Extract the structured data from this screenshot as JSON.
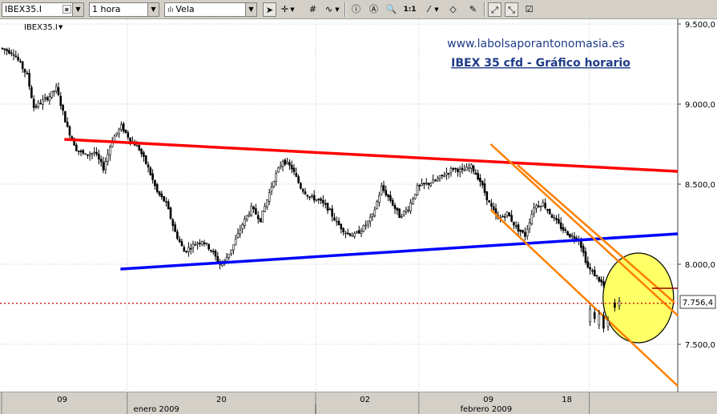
{
  "toolbar": {
    "symbol": "IBEX35.I",
    "timeframe": "1 hora",
    "chart_style": "Vela",
    "tools": [
      "cursor-arrow",
      "crosshair",
      "grid",
      "indicator",
      "info",
      "zoom",
      "one-to-one",
      "line-draw",
      "eraser",
      "highlighter",
      "auto-scale",
      "checkbox"
    ]
  },
  "chart_data": {
    "type": "candlestick",
    "symbol_label": "IBEX35.I",
    "source_text": "www.labolsaporantonomasia.es",
    "title": "IBEX 35 cfd - Gráfico horario",
    "y_ticks": [
      "9.500,0",
      "9.000,0",
      "8.500,0",
      "8.000,0",
      "7.500,0"
    ],
    "y_tick_values": [
      9500,
      9000,
      8500,
      8000,
      7500
    ],
    "ylim": [
      7200,
      9530
    ],
    "x_ticks": [
      "09",
      "20",
      "02",
      "09",
      "18"
    ],
    "months": [
      "enero 2009",
      "febrero 2009"
    ],
    "current_price_label": "7.756,4",
    "current_price": 7756.4,
    "bar_count": 290,
    "price_path": [
      [
        0,
        9350
      ],
      [
        6,
        9320
      ],
      [
        12,
        9180
      ],
      [
        15,
        8980
      ],
      [
        22,
        9050
      ],
      [
        25,
        9100
      ],
      [
        30,
        8850
      ],
      [
        34,
        8720
      ],
      [
        38,
        8680
      ],
      [
        42,
        8700
      ],
      [
        46,
        8600
      ],
      [
        50,
        8780
      ],
      [
        54,
        8860
      ],
      [
        58,
        8780
      ],
      [
        62,
        8720
      ],
      [
        66,
        8600
      ],
      [
        70,
        8450
      ],
      [
        74,
        8380
      ],
      [
        78,
        8200
      ],
      [
        82,
        8080
      ],
      [
        86,
        8120
      ],
      [
        90,
        8150
      ],
      [
        94,
        8090
      ],
      [
        98,
        8000
      ],
      [
        100,
        8020
      ],
      [
        104,
        8120
      ],
      [
        108,
        8250
      ],
      [
        112,
        8350
      ],
      [
        116,
        8280
      ],
      [
        118,
        8360
      ],
      [
        122,
        8530
      ],
      [
        126,
        8650
      ],
      [
        130,
        8600
      ],
      [
        134,
        8480
      ],
      [
        138,
        8420
      ],
      [
        142,
        8400
      ],
      [
        146,
        8350
      ],
      [
        150,
        8260
      ],
      [
        154,
        8200
      ],
      [
        158,
        8180
      ],
      [
        162,
        8230
      ],
      [
        166,
        8300
      ],
      [
        170,
        8480
      ],
      [
        174,
        8400
      ],
      [
        178,
        8300
      ],
      [
        182,
        8350
      ],
      [
        186,
        8480
      ],
      [
        190,
        8500
      ],
      [
        194,
        8520
      ],
      [
        198,
        8560
      ],
      [
        202,
        8600
      ],
      [
        206,
        8580
      ],
      [
        210,
        8610
      ],
      [
        214,
        8520
      ],
      [
        218,
        8380
      ],
      [
        222,
        8280
      ],
      [
        226,
        8320
      ],
      [
        230,
        8230
      ],
      [
        234,
        8180
      ],
      [
        238,
        8360
      ],
      [
        242,
        8380
      ],
      [
        246,
        8300
      ],
      [
        250,
        8230
      ],
      [
        254,
        8180
      ],
      [
        258,
        8160
      ],
      [
        262,
        7980
      ],
      [
        266,
        7920
      ],
      [
        270,
        7850
      ],
      [
        274,
        7830
      ],
      [
        278,
        7880
      ],
      [
        282,
        7850
      ],
      [
        284,
        7940
      ],
      [
        286,
        7870
      ],
      [
        288,
        7710
      ],
      [
        292,
        7670
      ],
      [
        296,
        7620
      ],
      [
        300,
        7730
      ],
      [
        303,
        7756
      ]
    ],
    "lines": [
      {
        "name": "red-resistance",
        "color": "#ff0000",
        "from": [
          28,
          8780
        ],
        "to": [
          360,
          8580
        ]
      },
      {
        "name": "blue-support",
        "color": "#0000ff",
        "from": [
          53,
          7970
        ],
        "to": [
          360,
          8190
        ]
      },
      {
        "name": "orange-channel-upper",
        "color": "#ff8000",
        "from": [
          218,
          8750
        ],
        "to": [
          360,
          7680
        ]
      },
      {
        "name": "orange-channel-lower",
        "color": "#ff8000",
        "from": [
          218,
          8340
        ],
        "to": [
          360,
          7240
        ]
      },
      {
        "name": "orange-channel-mid",
        "color": "#ff8000",
        "from": [
          230,
          8620
        ],
        "to": [
          300,
          7760
        ]
      },
      {
        "name": "darkred-level",
        "color": "#990000",
        "from": [
          290,
          7850
        ],
        "to": [
          360,
          7850
        ]
      }
    ],
    "grid": true,
    "highlight": {
      "shape": "ellipse",
      "color": "#ffff66",
      "center": [
        296,
        7790
      ]
    },
    "colors": {
      "background": "#ffffff",
      "up_candle": "#ffffff",
      "down_candle": "#000000",
      "price_line": "#cc0000",
      "title": "#1f3c88"
    }
  }
}
